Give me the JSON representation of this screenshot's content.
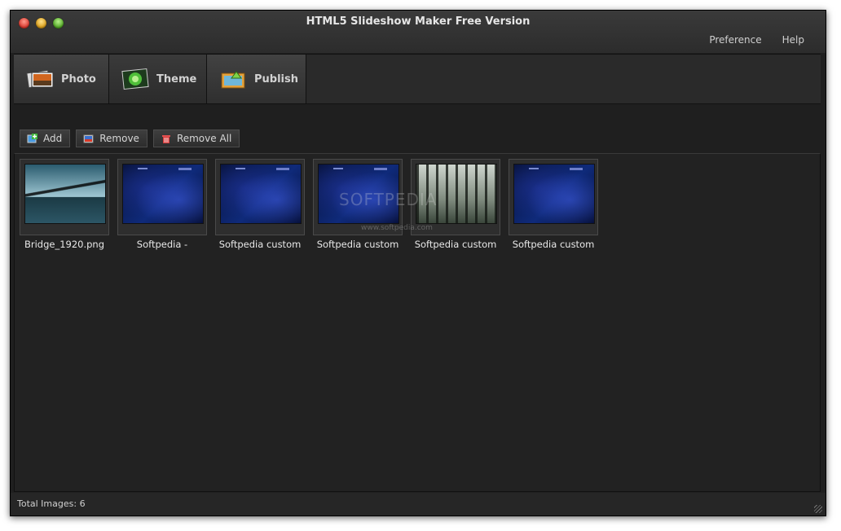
{
  "window": {
    "title": "HTML5 Slideshow Maker Free Version"
  },
  "menu": {
    "items": [
      "Preference",
      "Help"
    ]
  },
  "tabs": [
    {
      "label": "Photo",
      "icon": "photo-stack-icon"
    },
    {
      "label": "Theme",
      "icon": "theme-icon"
    },
    {
      "label": "Publish",
      "icon": "publish-icon"
    }
  ],
  "toolbar": {
    "add_label": "Add",
    "remove_label": "Remove",
    "remove_all_label": "Remove All"
  },
  "images": [
    {
      "caption": "Bridge_1920.png",
      "thumb": "bridge"
    },
    {
      "caption": "Softpedia -",
      "thumb": "blue"
    },
    {
      "caption": "Softpedia custom",
      "thumb": "blue"
    },
    {
      "caption": "Softpedia custom",
      "thumb": "blue"
    },
    {
      "caption": "Softpedia custom",
      "thumb": "forest"
    },
    {
      "caption": "Softpedia custom",
      "thumb": "blue"
    }
  ],
  "watermark": {
    "text": "SOFTPEDIA",
    "url": "www.softpedia.com"
  },
  "status": {
    "total_images": "Total Images: 6"
  }
}
